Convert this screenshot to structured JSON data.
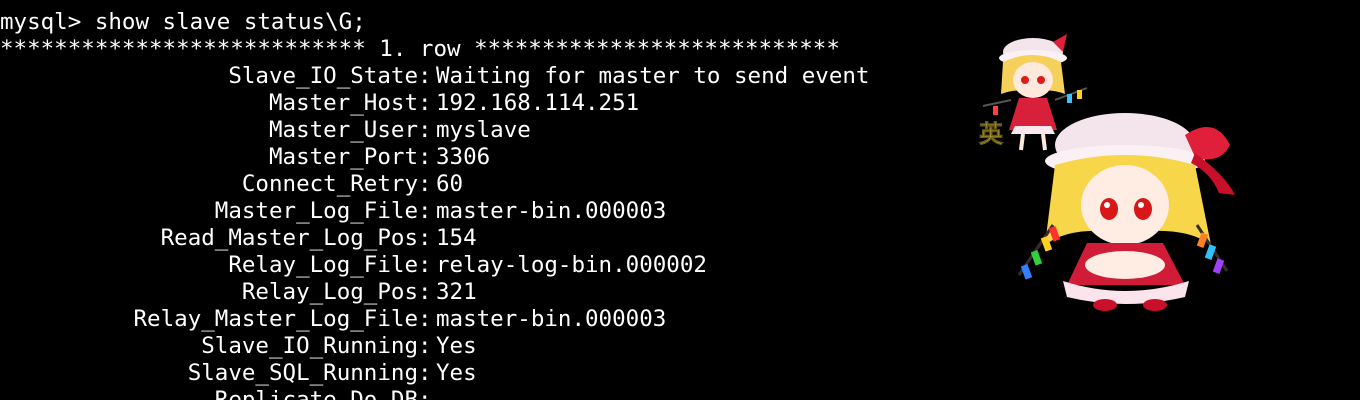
{
  "terminal": {
    "prompt_line": "mysql> show slave status\\G;",
    "row_header": "*************************** 1. row ***************************",
    "fields": [
      {
        "key": "Slave_IO_State",
        "value": "Waiting for master to send event"
      },
      {
        "key": "Master_Host",
        "value": "192.168.114.251"
      },
      {
        "key": "Master_User",
        "value": "myslave"
      },
      {
        "key": "Master_Port",
        "value": "3306"
      },
      {
        "key": "Connect_Retry",
        "value": "60"
      },
      {
        "key": "Master_Log_File",
        "value": "master-bin.000003"
      },
      {
        "key": "Read_Master_Log_Pos",
        "value": "154"
      },
      {
        "key": "Relay_Log_File",
        "value": "relay-log-bin.000002"
      },
      {
        "key": "Relay_Log_Pos",
        "value": "321"
      },
      {
        "key": "Relay_Master_Log_File",
        "value": "master-bin.000003"
      },
      {
        "key": "Slave_IO_Running",
        "value": "Yes"
      },
      {
        "key": "Slave_SQL_Running",
        "value": "Yes"
      },
      {
        "key": "Replicate_Do_DB",
        "value": ""
      }
    ]
  },
  "stickers": {
    "small_badge_text": "英"
  },
  "colors": {
    "background": "#000000",
    "text": "#ffffff"
  }
}
